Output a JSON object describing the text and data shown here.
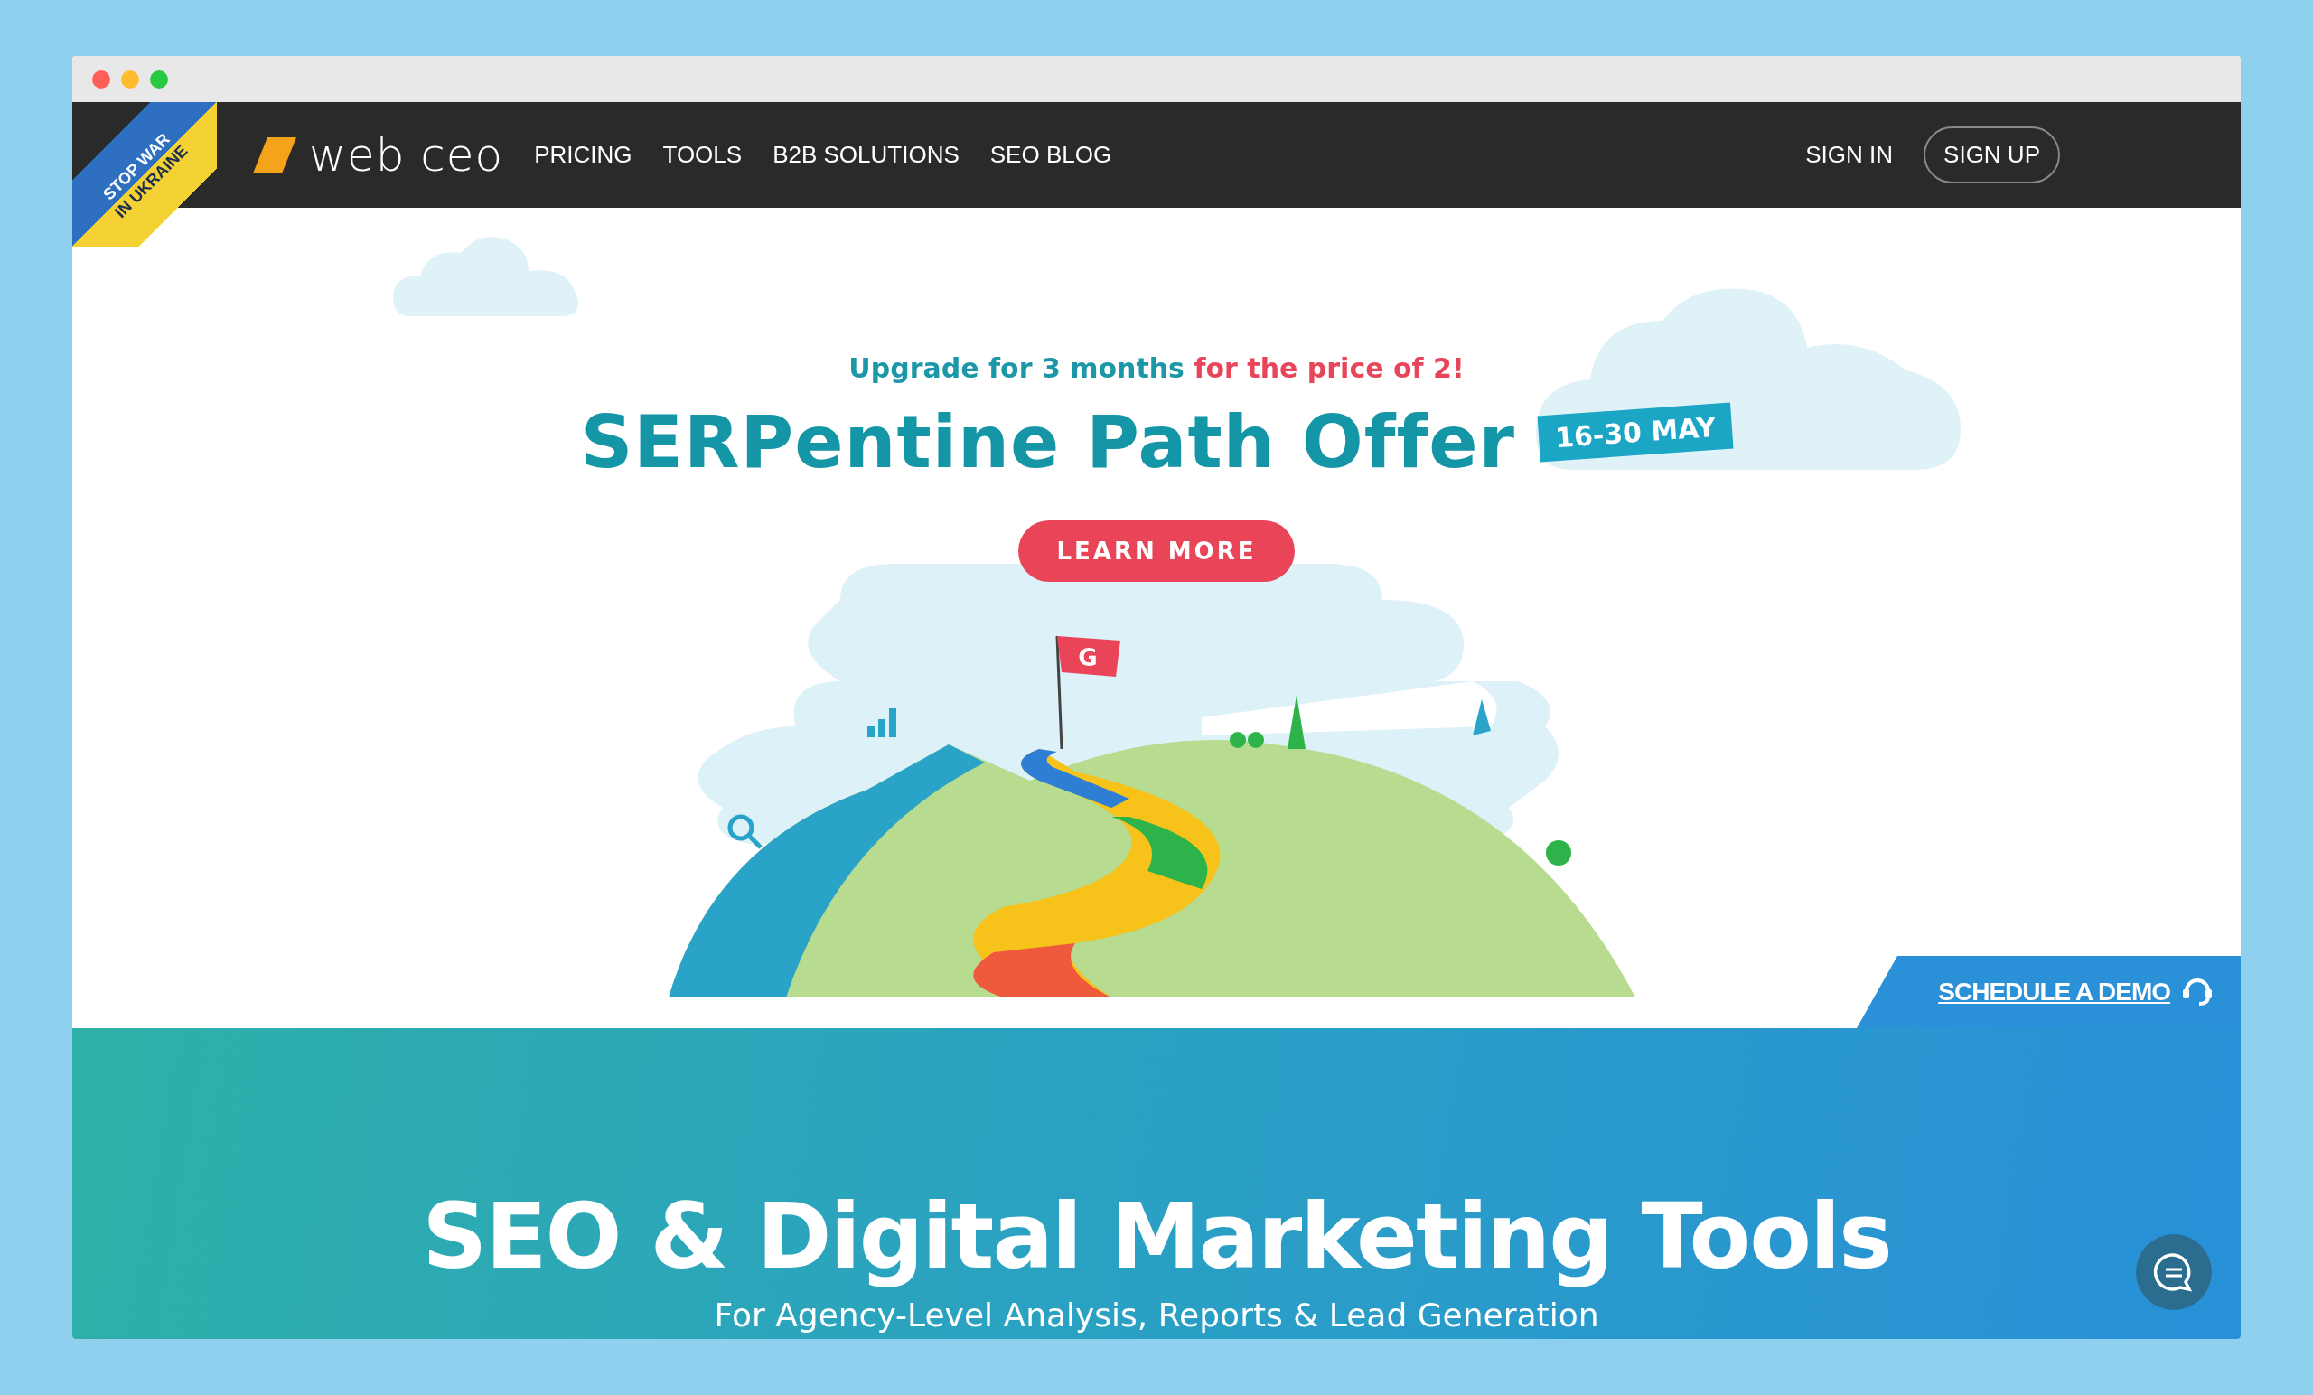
{
  "ribbon": {
    "lines": [
      "STOP WAR",
      "IN UKRAINE"
    ]
  },
  "nav": {
    "logo": "web ceo",
    "links": [
      {
        "label": "PRICING"
      },
      {
        "label": "TOOLS"
      },
      {
        "label": "B2B SOLUTIONS"
      },
      {
        "label": "SEO BLOG"
      }
    ],
    "sign_in": "SIGN IN",
    "sign_up": "SIGN UP"
  },
  "promo": {
    "lead": "Upgrade for 3 months",
    "highlight": "for the price of 2!",
    "title": "SERPentine Path Offer",
    "date_badge": "16-30 MAY",
    "button": "LEARN MORE",
    "flag_label": "G"
  },
  "schedule_demo": "SCHEDULE A DEMO",
  "band": {
    "title": "SEO & Digital Marketing Tools",
    "subtitle": "For Agency-Level Analysis, Reports & Lead Generation"
  }
}
